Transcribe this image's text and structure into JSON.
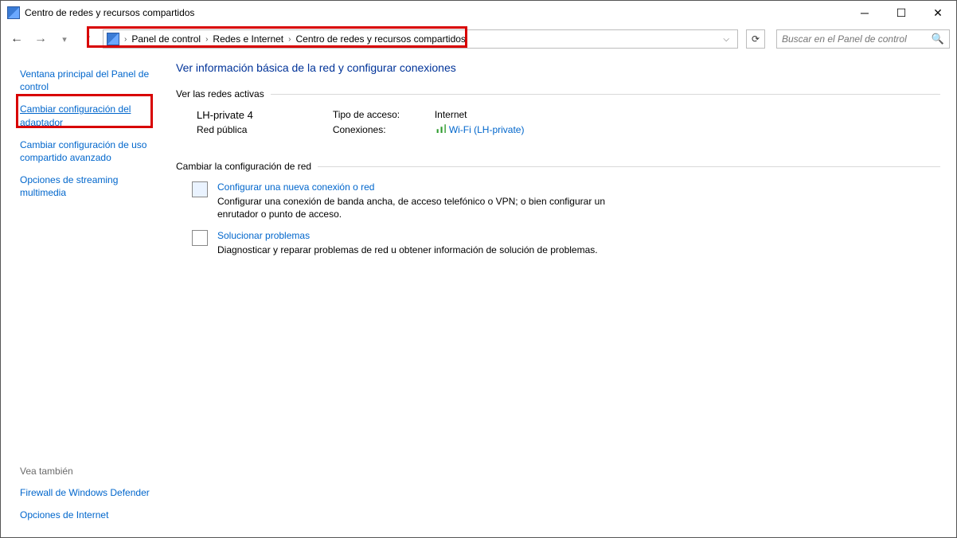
{
  "window": {
    "title": "Centro de redes y recursos compartidos"
  },
  "breadcrumb": {
    "seg1": "Panel de control",
    "seg2": "Redes e Internet",
    "seg3": "Centro de redes y recursos compartidos"
  },
  "search": {
    "placeholder": "Buscar en el Panel de control"
  },
  "sidebar": {
    "link1": "Ventana principal del Panel de control",
    "link2": "Cambiar configuración del adaptador",
    "link3": "Cambiar configuración de uso compartido avanzado",
    "link4": "Opciones de streaming multimedia",
    "see_also": "Vea también",
    "link5": "Firewall de Windows Defender",
    "link6": "Opciones de Internet"
  },
  "main": {
    "title": "Ver información básica de la red y configurar conexiones",
    "active_networks_label": "Ver las redes activas",
    "network": {
      "name": "LH-private 4",
      "type": "Red pública",
      "access_label": "Tipo de acceso:",
      "access_value": "Internet",
      "conn_label": "Conexiones:",
      "conn_value": "Wi-Fi (LH-private)"
    },
    "change_label": "Cambiar la configuración de red",
    "task1": {
      "link": "Configurar una nueva conexión o red",
      "desc": "Configurar una conexión de banda ancha, de acceso telefónico o VPN; o bien configurar un enrutador o punto de acceso."
    },
    "task2": {
      "link": "Solucionar problemas",
      "desc": "Diagnosticar y reparar problemas de red u obtener información de solución de problemas."
    }
  }
}
